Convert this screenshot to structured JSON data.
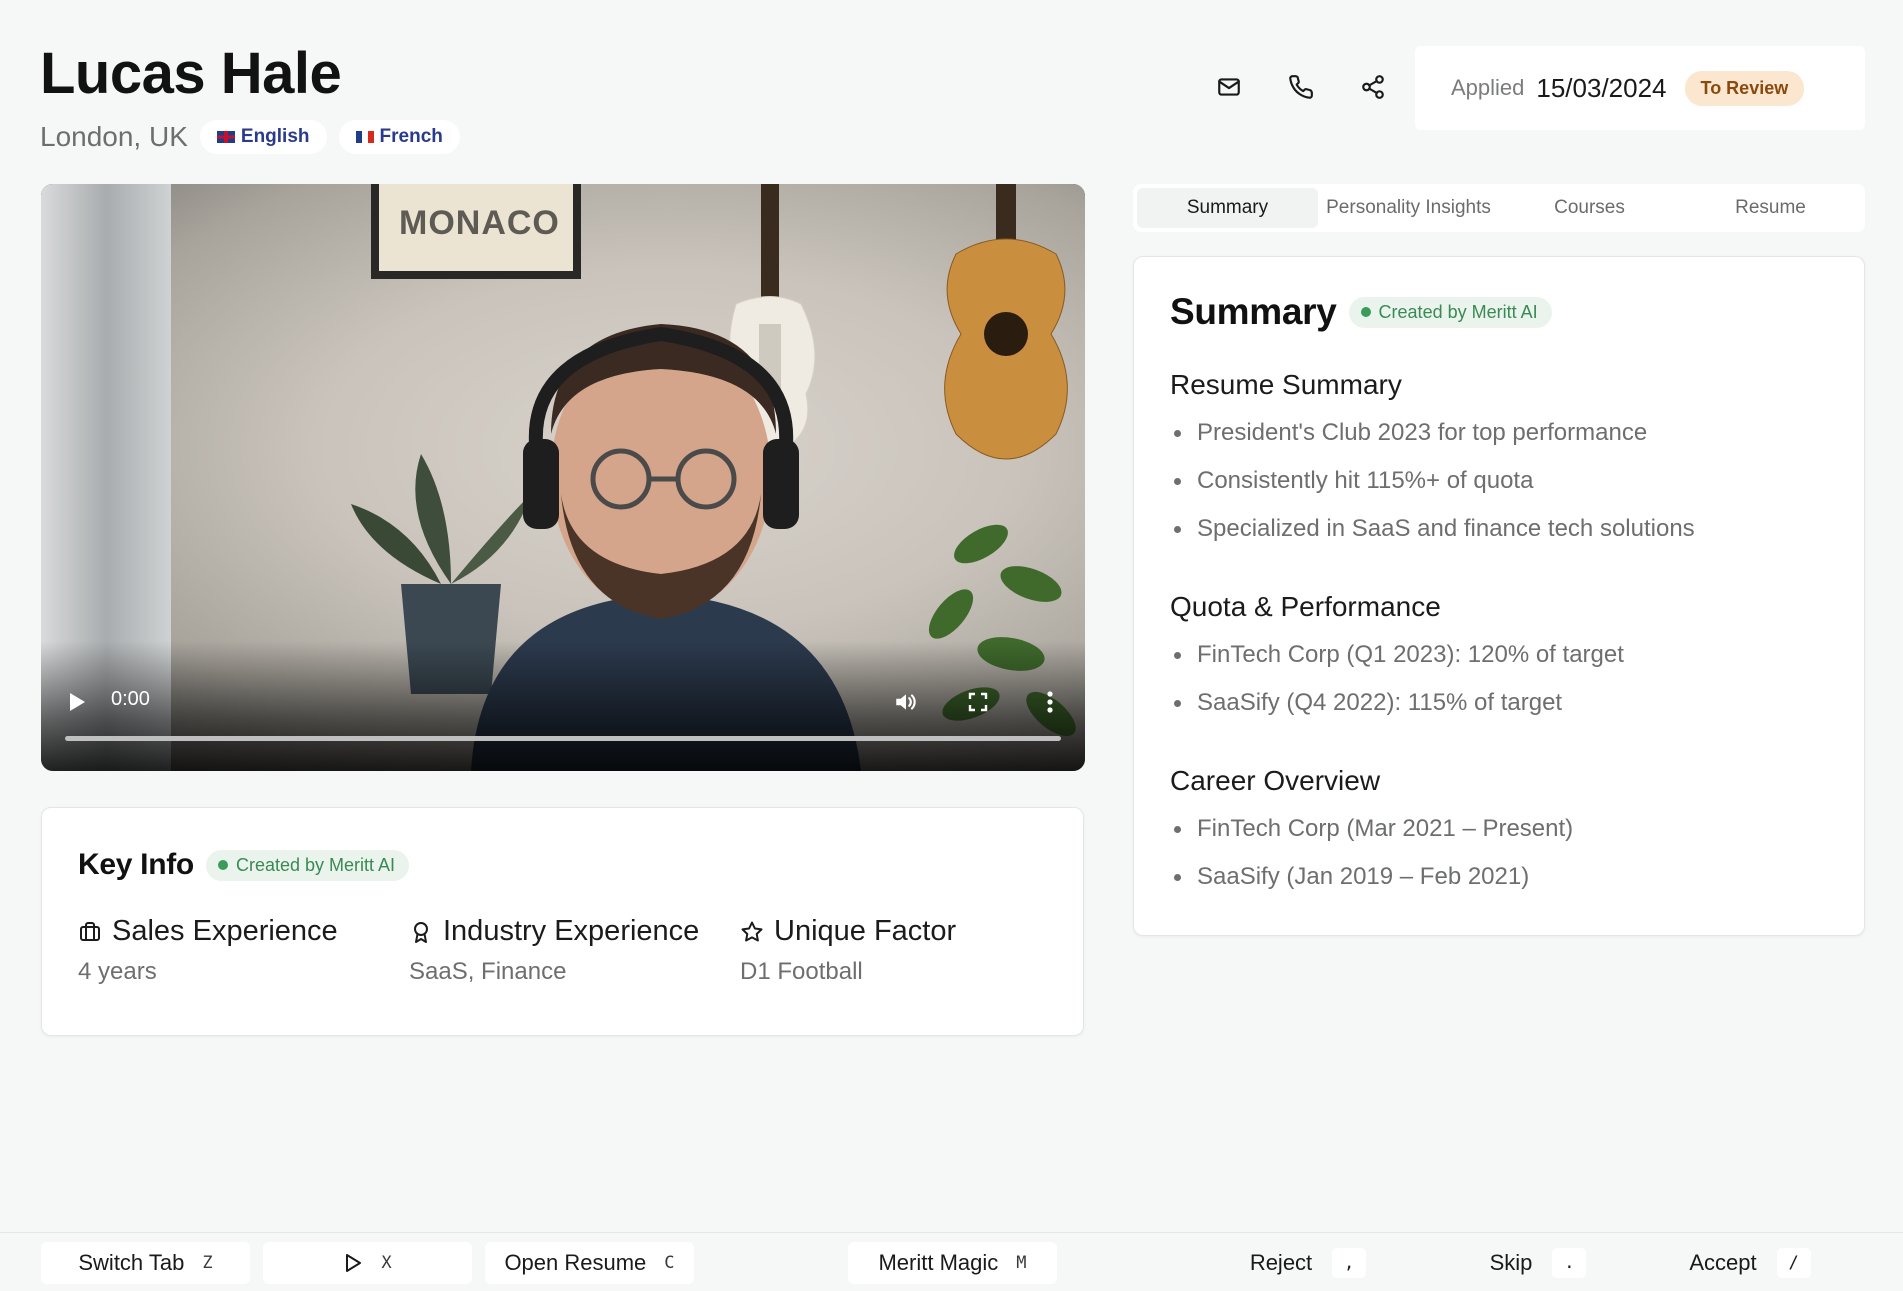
{
  "candidate": {
    "name": "Lucas Hale",
    "location": "London, UK",
    "languages": [
      "English",
      "French"
    ]
  },
  "header": {
    "actions": [
      {
        "icon": "mail-icon"
      },
      {
        "icon": "phone-icon"
      },
      {
        "icon": "share-icon"
      }
    ],
    "applied_label": "Applied",
    "applied_date": "15/03/2024",
    "status": "To Review",
    "status_color": "#fbe7cf"
  },
  "video": {
    "time": "0:00",
    "progress": 0,
    "poster_text": "MONACO"
  },
  "key_info": {
    "title": "Key Info",
    "badge": "Created by Meritt AI",
    "items": [
      {
        "icon": "briefcase-icon",
        "label": "Sales Experience",
        "value": "4 years"
      },
      {
        "icon": "award-icon",
        "label": "Industry Experience",
        "value": "SaaS, Finance"
      },
      {
        "icon": "star-icon",
        "label": "Unique Factor",
        "value": "D1 Football"
      }
    ]
  },
  "tabs": [
    "Summary",
    "Personality Insights",
    "Courses",
    "Resume"
  ],
  "active_tab": "Summary",
  "summary": {
    "title": "Summary",
    "badge": "Created by Meritt AI",
    "sections": [
      {
        "heading": "Resume Summary",
        "items": [
          "President's Club 2023 for top performance",
          "Consistently hit 115%+ of quota",
          "Specialized in SaaS and finance tech solutions"
        ]
      },
      {
        "heading": "Quota & Performance",
        "items": [
          "FinTech Corp (Q1 2023): 120% of target",
          "SaaSify (Q4 2022): 115% of target"
        ]
      },
      {
        "heading": "Career Overview",
        "items": [
          "FinTech Corp (Mar 2021 – Present)",
          "SaaSify (Jan 2019 – Feb 2021)"
        ]
      }
    ]
  },
  "bottom_bar": {
    "switch_tab": {
      "label": "Switch Tab",
      "key": "Z"
    },
    "play": {
      "key": "X"
    },
    "open_resume": {
      "label": "Open Resume",
      "key": "C"
    },
    "meritt_magic": {
      "label": "Meritt Magic",
      "key": "M"
    },
    "reject": {
      "label": "Reject",
      "key": ","
    },
    "skip": {
      "label": "Skip",
      "key": "."
    },
    "accept": {
      "label": "Accept",
      "key": "/"
    }
  },
  "colors": {
    "accent_green": "#3a9b5a",
    "badge_bg": "#eaf3ec",
    "status_text": "#8a4a0e"
  }
}
